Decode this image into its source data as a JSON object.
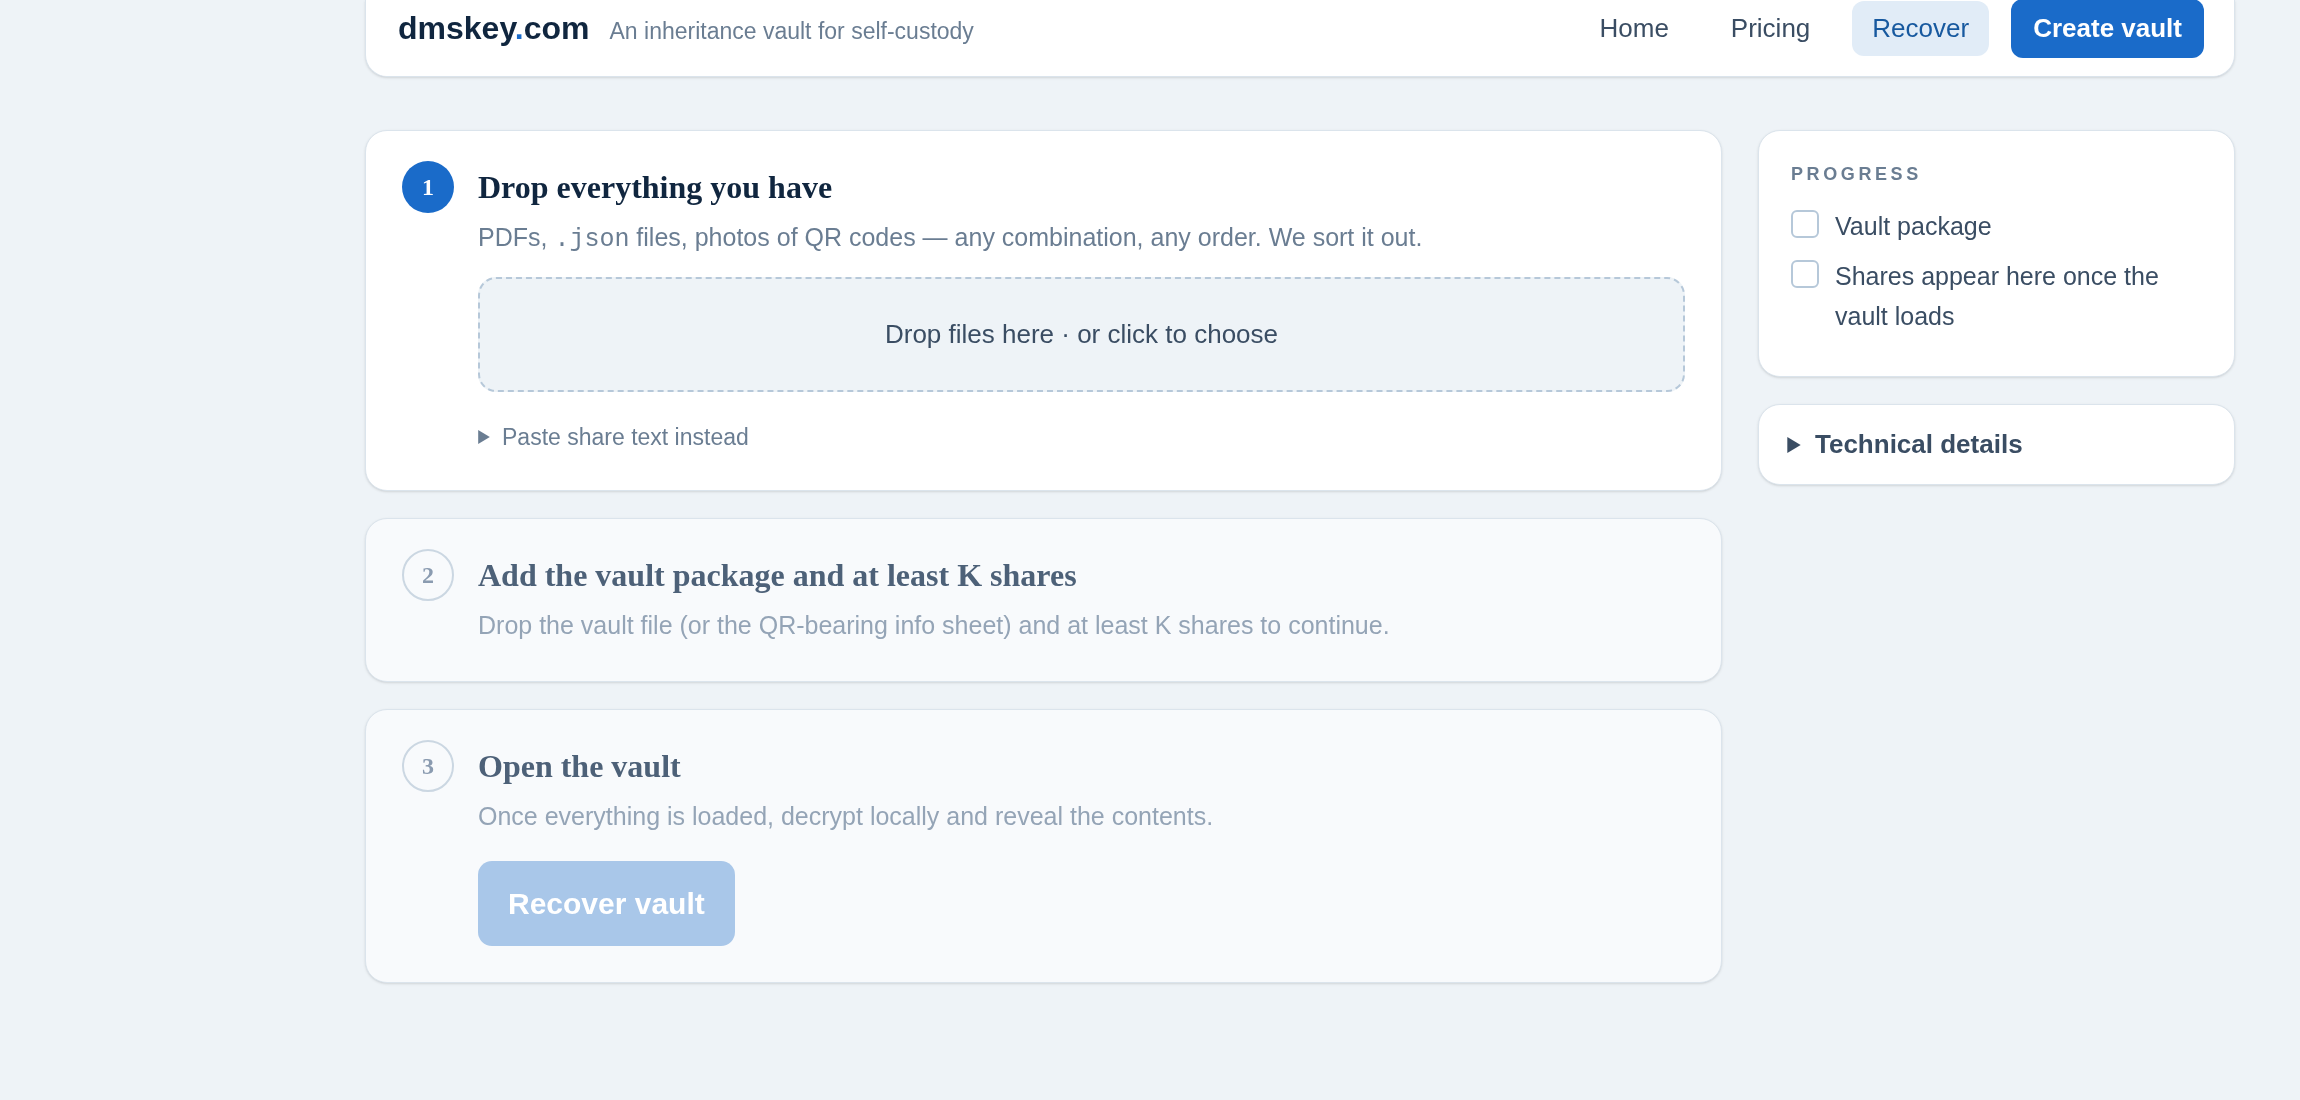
{
  "header": {
    "brand": {
      "name": "dmskey",
      "dot": ".",
      "tld": "com"
    },
    "tagline": "An inheritance vault for self-custody",
    "nav": [
      {
        "label": "Home",
        "selected": false
      },
      {
        "label": "Pricing",
        "selected": false
      },
      {
        "label": "Recover",
        "selected": true
      }
    ],
    "cta": "Create vault"
  },
  "steps": [
    {
      "number": "1",
      "active": true,
      "title": "Drop everything you have",
      "description": [
        {
          "kind": "text",
          "text": "PDFs, "
        },
        {
          "kind": "code",
          "text": ".json"
        },
        {
          "kind": "text",
          "text": " files, photos of QR codes — any combination, any order. We sort it out."
        }
      ],
      "dropzone": "Drop files here · or click to choose",
      "disclosure": {
        "label": "Paste share text instead",
        "expanded": false
      }
    },
    {
      "number": "2",
      "active": false,
      "title": "Add the vault package and at least K shares",
      "description": [
        {
          "kind": "text",
          "text": "Drop the vault file (or the QR-bearing info sheet) and at least K shares to continue."
        }
      ]
    },
    {
      "number": "3",
      "active": false,
      "title": "Open the vault",
      "description": [
        {
          "kind": "text",
          "text": "Once everything is loaded, decrypt locally and reveal the contents."
        }
      ],
      "button": {
        "label": "Recover vault",
        "disabled": true
      }
    }
  ],
  "sidebar": {
    "progress": {
      "heading": "PROGRESS",
      "items": [
        {
          "label": "Vault package",
          "checked": false
        },
        {
          "label": "Shares appear here once the vault loads",
          "checked": false
        }
      ]
    },
    "technical": {
      "label": "Technical details",
      "expanded": false
    }
  }
}
